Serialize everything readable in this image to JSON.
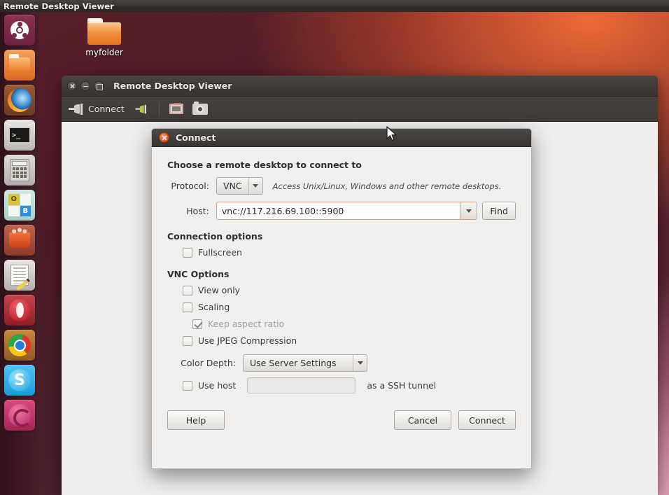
{
  "panel": {
    "title": "Remote Desktop Viewer"
  },
  "launcher": {
    "items": [
      {
        "name": "ubuntu-dash",
        "label": "Dash home"
      },
      {
        "name": "files",
        "label": "Files"
      },
      {
        "name": "firefox",
        "label": "Firefox Web Browser"
      },
      {
        "name": "terminal",
        "label": "Terminal"
      },
      {
        "name": "calculator",
        "label": "Calculator"
      },
      {
        "name": "office",
        "label": "OpenOffice"
      },
      {
        "name": "software-center",
        "label": "Ubuntu Software Center"
      },
      {
        "name": "text-editor",
        "label": "Text Editor"
      },
      {
        "name": "opera",
        "label": "Opera"
      },
      {
        "name": "chrome",
        "label": "Google Chrome"
      },
      {
        "name": "skype",
        "label": "Skype"
      },
      {
        "name": "ubuntu-one",
        "label": "Ubuntu One"
      }
    ]
  },
  "desktop": {
    "folder": {
      "label": "myfolder"
    }
  },
  "app_window": {
    "title": "Remote Desktop Viewer",
    "toolbar": {
      "connect_label": "Connect",
      "disconnect_icon": "plug-disconnect-icon",
      "fullscreen_icon": "fullscreen-icon",
      "screenshot_icon": "camera-icon"
    }
  },
  "dialog": {
    "title": "Connect",
    "heading": "Choose a remote desktop to connect to",
    "protocol": {
      "label": "Protocol:",
      "value": "VNC",
      "hint": "Access Unix/Linux, Windows and other remote desktops."
    },
    "host": {
      "label": "Host:",
      "value": "vnc://117.216.69.100::5900",
      "placeholder": "",
      "find_label": "Find"
    },
    "connection_options": {
      "heading": "Connection options",
      "fullscreen": {
        "label": "Fullscreen",
        "checked": false
      }
    },
    "vnc_options": {
      "heading": "VNC Options",
      "view_only": {
        "label": "View only",
        "checked": false
      },
      "scaling": {
        "label": "Scaling",
        "checked": false
      },
      "keep_aspect_ratio": {
        "label": "Keep aspect ratio",
        "checked": true,
        "disabled": true
      },
      "jpeg": {
        "label": "Use JPEG Compression",
        "checked": false
      },
      "color_depth": {
        "label": "Color Depth:",
        "value": "Use Server Settings"
      },
      "ssh": {
        "prefix_label": "Use host",
        "suffix_label": "as a SSH tunnel",
        "host_value": "",
        "checked": false
      }
    },
    "buttons": {
      "help": "Help",
      "cancel": "Cancel",
      "connect": "Connect"
    }
  },
  "colors": {
    "accent_orange": "#dd4814",
    "panel_bg": "#3c3733",
    "dialog_bg": "#f2f0ef",
    "focus_border": "#d9a183"
  }
}
